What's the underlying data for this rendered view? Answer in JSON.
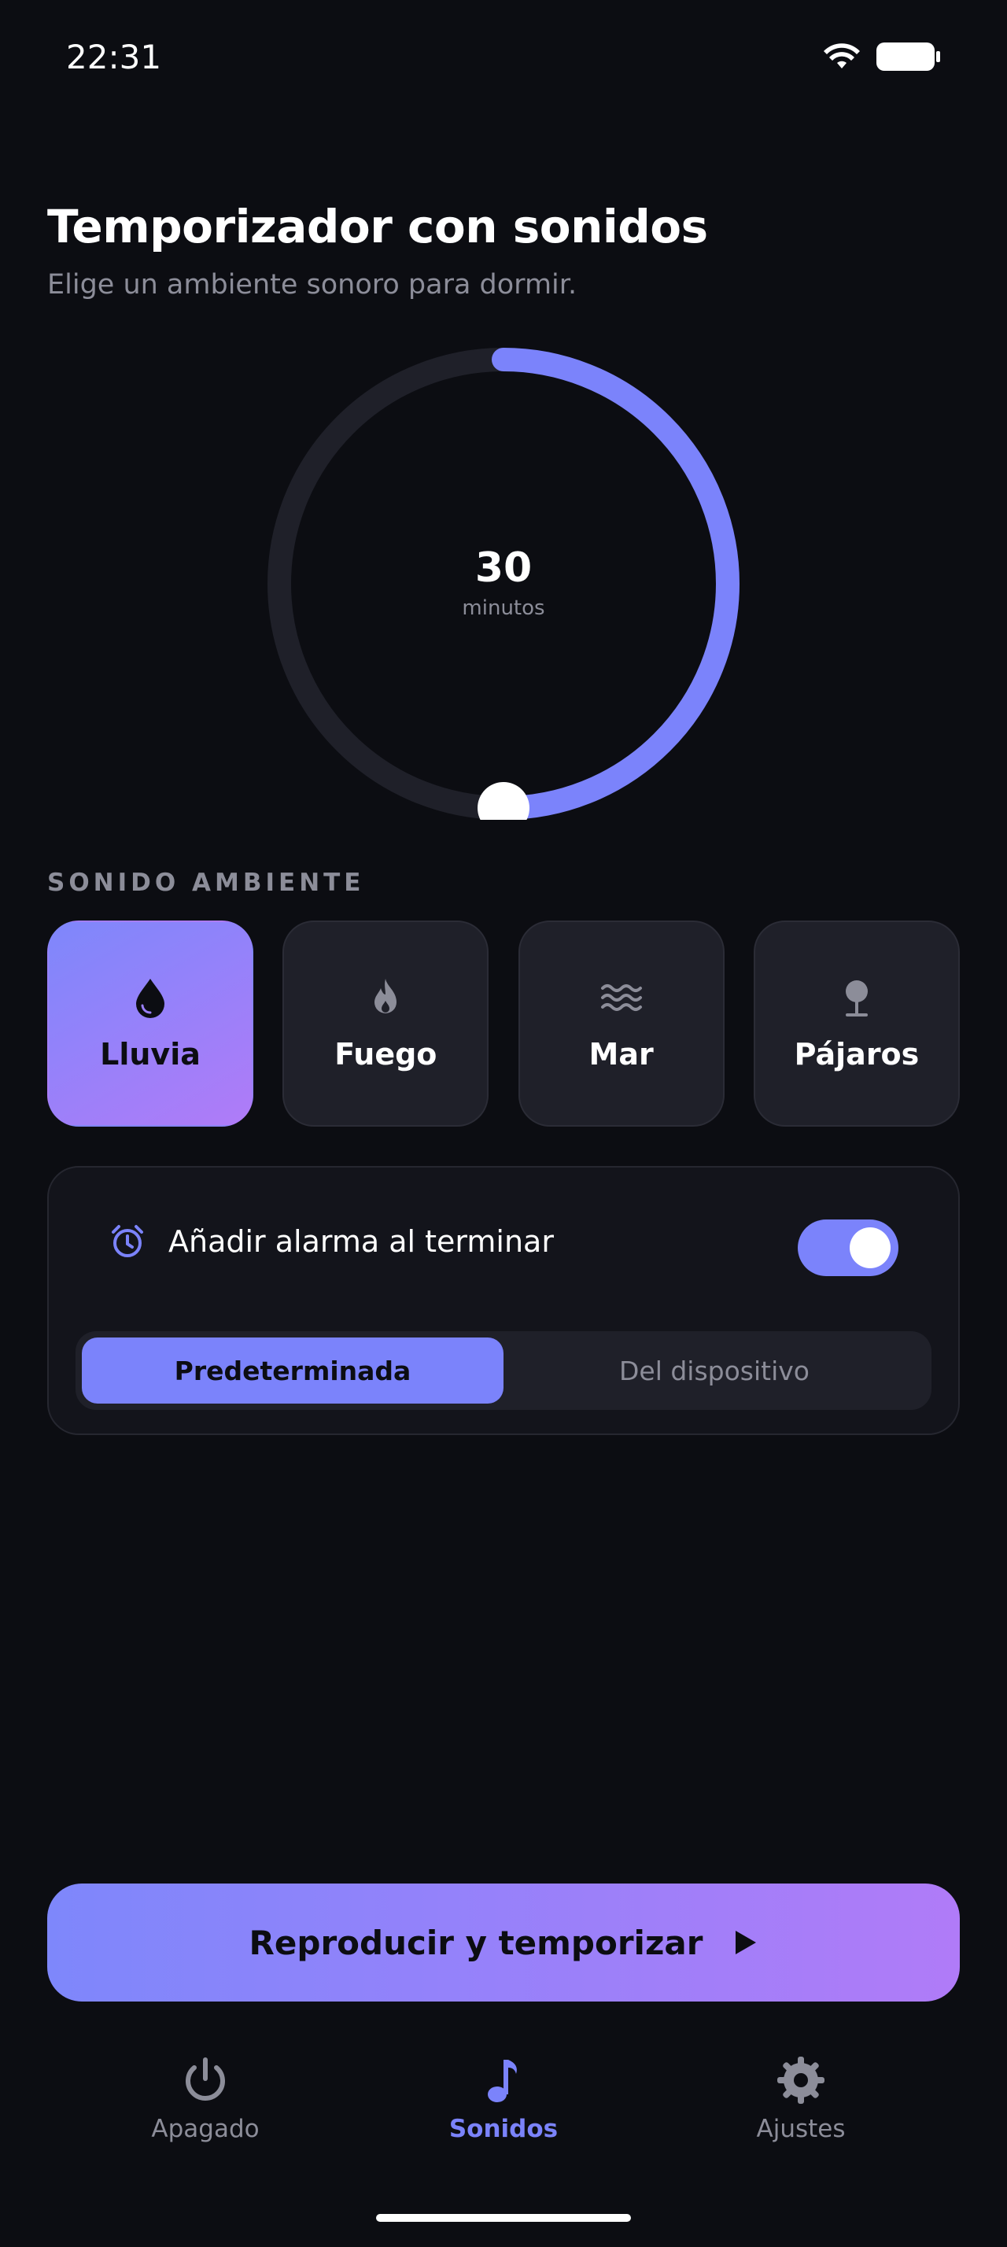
{
  "status_bar": {
    "time": "22:31",
    "icons": [
      "wifi-icon",
      "battery-icon"
    ]
  },
  "header": {
    "title": "Temporizador con sonidos",
    "subtitle": "Elige un ambiente sonoro para dormir."
  },
  "timer": {
    "value": "30",
    "unit": "minutos",
    "progress_fraction": 0.5
  },
  "ambient": {
    "section_label": "SONIDO AMBIENTE",
    "sounds": [
      {
        "label": "Lluvia",
        "icon": "raindrop-icon",
        "selected": true
      },
      {
        "label": "Fuego",
        "icon": "flame-icon",
        "selected": false
      },
      {
        "label": "Mar",
        "icon": "waves-icon",
        "selected": false
      },
      {
        "label": "Pájaros",
        "icon": "tree-icon",
        "selected": false
      }
    ]
  },
  "alarm": {
    "label": "Añadir alarma al terminar",
    "icon": "alarm-clock-icon",
    "enabled": true,
    "options": [
      "Predeterminada",
      "Del dispositivo"
    ],
    "selected_option": "Predeterminada"
  },
  "play_button": {
    "label": "Reproducir y temporizar",
    "icon": "play-icon"
  },
  "bottom_nav": {
    "items": [
      {
        "label": "Apagado",
        "icon": "power-icon"
      },
      {
        "label": "Sonidos",
        "icon": "music-note-icon",
        "active": true
      },
      {
        "label": "Ajustes",
        "icon": "gear-icon"
      }
    ]
  },
  "colors": {
    "background": "#0c0d12",
    "accent": "#7b83fb",
    "accent_gradient_end": "#b07bf8",
    "muted_text": "#8c8d99",
    "surface": "#1f2029"
  }
}
